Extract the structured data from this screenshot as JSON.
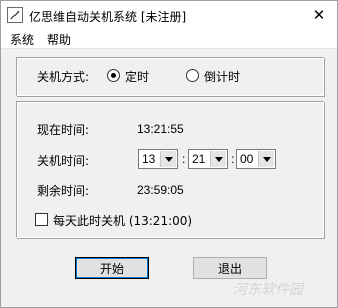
{
  "window": {
    "title": "亿思维自动关机系统 [未注册]",
    "close_glyph": "✕"
  },
  "menu": {
    "items": [
      "系统",
      "帮助"
    ]
  },
  "shutdown_mode": {
    "label": "关机方式:",
    "options": [
      {
        "label": "定时",
        "selected": true
      },
      {
        "label": "倒计时",
        "selected": false
      }
    ]
  },
  "main": {
    "current_time_label": "现在时间:",
    "current_time_value": "13:21:55",
    "shutdown_time_label": "关机时间:",
    "hour": "13",
    "minute": "21",
    "second": "00",
    "separator": ":",
    "remaining_label": "剩余时间:",
    "remaining_value": "23:59:05",
    "daily_checkbox_label": "每天此时关机 (13:21:00)",
    "daily_checked": false
  },
  "buttons": {
    "start": "开始",
    "exit": "退出"
  },
  "watermark": "河东软件园"
}
